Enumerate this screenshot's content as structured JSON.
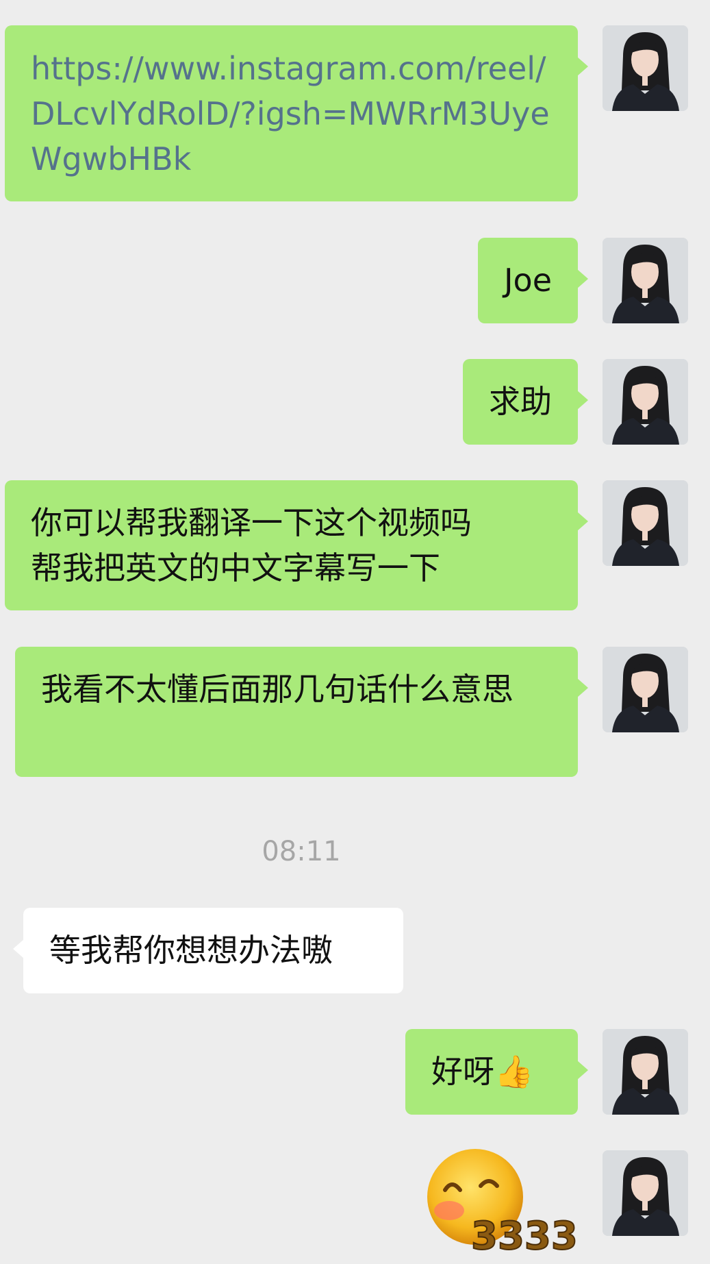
{
  "messages": [
    {
      "id": "m1",
      "text": "https://www.instagram.com/reel/DLcvlYdRolD/?igsh=MWRrM3UyeWgwbHBk"
    },
    {
      "id": "m2",
      "text": "Joe"
    },
    {
      "id": "m3",
      "text": "求助"
    },
    {
      "id": "m4_line1",
      "text": "你可以帮我翻译一下这个视频吗"
    },
    {
      "id": "m4_line2",
      "text": "帮我把英文的中文字幕写一下"
    },
    {
      "id": "m5",
      "text": "我看不太懂后面那几句话什么意思"
    },
    {
      "id": "timestamp",
      "text": "08:11"
    },
    {
      "id": "m6_incoming",
      "text": "等我帮你想想办法嗷"
    },
    {
      "id": "m7",
      "text": "好呀👍"
    },
    {
      "id": "m8_sticker",
      "text": "3333"
    }
  ],
  "chat": {
    "link": "https://www.instagram.com/reel/DLcvlYdRolD/?igsh=MWRrM3UyeWgwbHBk",
    "msg_joe": "Joe",
    "msg_help": "求助",
    "msg_translate_1": "你可以帮我翻译一下这个视频吗",
    "msg_translate_2": "帮我把英文的中文字幕写一下",
    "msg_dont_understand": "我看不太懂后面那几句话什么意思",
    "time": "08:11",
    "reply": "等我帮你想想办法嗷",
    "msg_ok": "好呀",
    "msg_ok_emoji": "👍",
    "sticker_text": "3333"
  },
  "colors": {
    "background": "#ededed",
    "outgoing_bubble": "#a9ea7a",
    "incoming_bubble": "#ffffff",
    "link_text": "#55728c",
    "timestamp_text": "#a6a6a6"
  },
  "icons": {
    "avatar": "user-avatar-photo",
    "sticker": "blushing-face-sticker",
    "thumbs_up": "thumbs-up-emoji"
  }
}
